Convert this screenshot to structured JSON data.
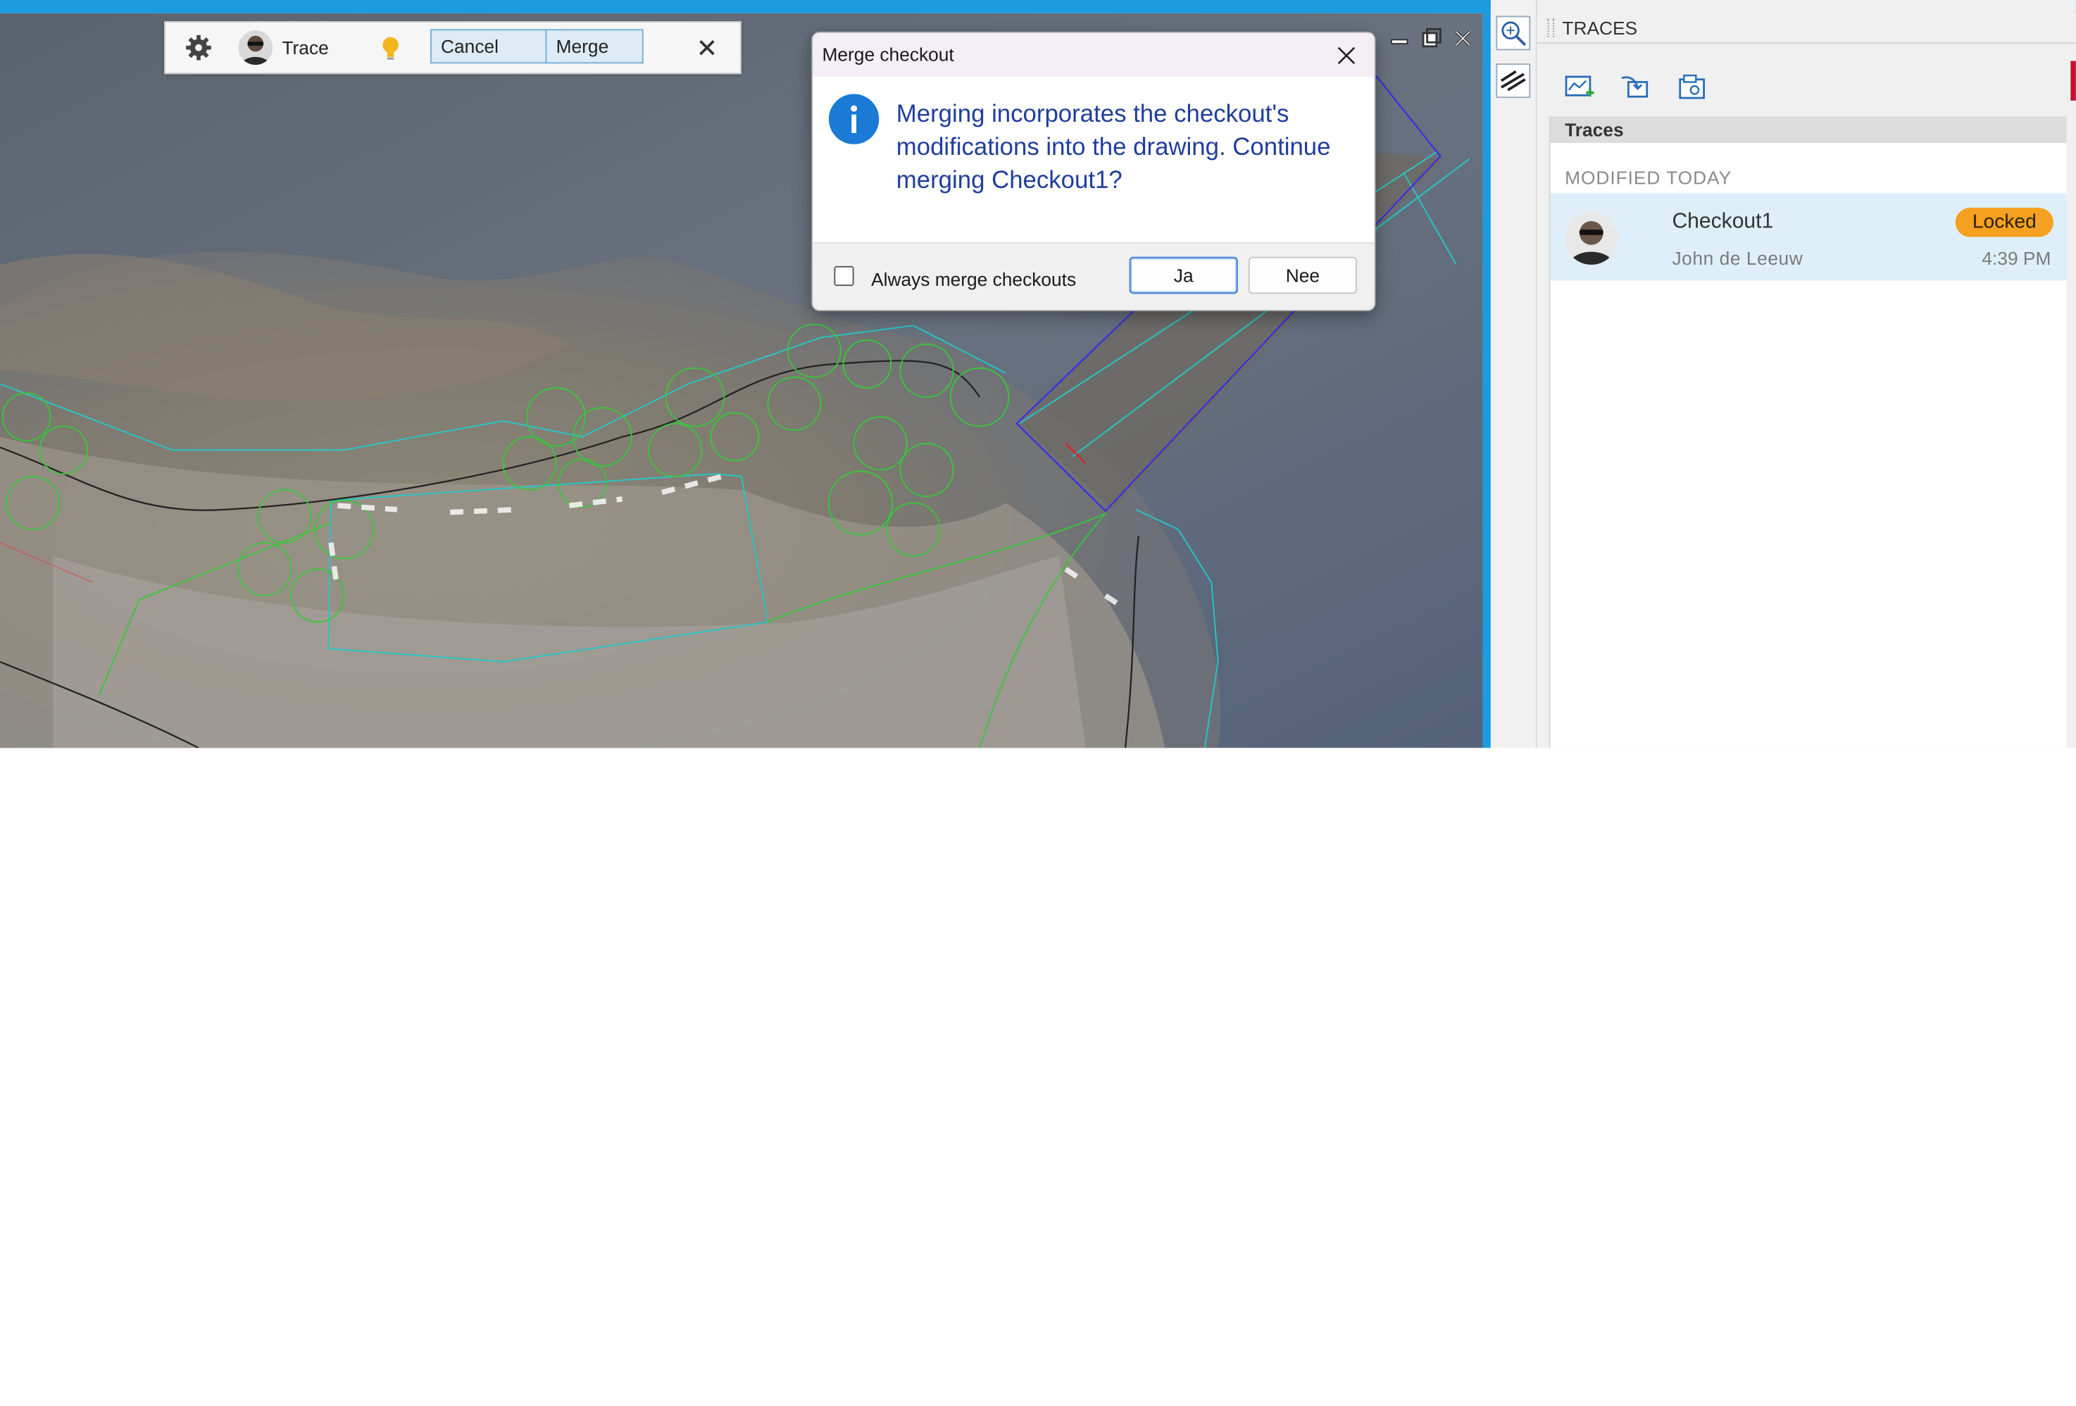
{
  "trace_toolbar": {
    "settings_icon": "gear-icon",
    "avatar_icon": "user-avatar",
    "label": "Trace",
    "hint_icon": "lightbulb-icon",
    "cancel_label": "Cancel",
    "merge_label": "Merge",
    "close_icon": "close-icon"
  },
  "window_controls": [
    "minimize-icon",
    "restore-icon",
    "close-icon"
  ],
  "dialog": {
    "title": "Merge checkout",
    "message": "Merging incorporates the checkout's modifications into the drawing. Continue merging Checkout1?",
    "icon": "info-icon",
    "checkbox_label": "Always merge checkouts",
    "checkbox_checked": false,
    "yes_label": "Ja",
    "no_label": "Nee"
  },
  "gutter": {
    "tools": [
      "zoom-extents-icon",
      "hatch-icon"
    ]
  },
  "panel": {
    "title": "TRACES",
    "toolbar_icons": [
      "new-trace-icon",
      "import-trace-icon",
      "manage-trace-icon"
    ],
    "section_title": "Traces",
    "group_label": "MODIFIED TODAY",
    "items": [
      {
        "name": "Checkout1",
        "author": "John de Leeuw",
        "status": "Locked",
        "time": "4:39 PM"
      }
    ]
  },
  "colors": {
    "accent_blue": "#1b9be0",
    "dialog_text": "#1f3e9c",
    "locked_badge": "#f5a020",
    "selected_row": "#dfeff9"
  }
}
